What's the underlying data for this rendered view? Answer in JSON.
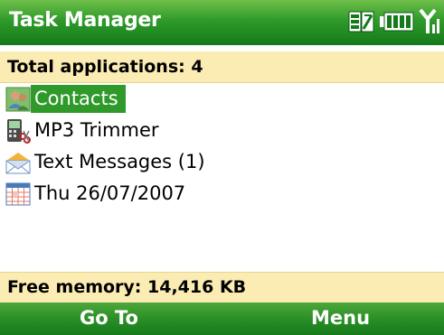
{
  "window": {
    "title": "Task Manager"
  },
  "status_icons": [
    "connection-icon",
    "battery-icon",
    "signal-icon"
  ],
  "header": {
    "summary": "Total applications: 4"
  },
  "applications": [
    {
      "name": "Contacts",
      "icon": "contacts-icon",
      "selected": true
    },
    {
      "name": "MP3 Trimmer",
      "icon": "mp3-trimmer-icon",
      "selected": false
    },
    {
      "name": "Text Messages (1)",
      "icon": "envelope-icon",
      "selected": false
    },
    {
      "name": "Thu 26/07/2007",
      "icon": "calendar-icon",
      "selected": false
    }
  ],
  "footer": {
    "memory": "Free memory: 14,416 KB"
  },
  "softkeys": {
    "left": "Go To",
    "right": "Menu"
  },
  "colors": {
    "accent_green": "#2f9a2a",
    "info_bar": "#fbecb4"
  }
}
